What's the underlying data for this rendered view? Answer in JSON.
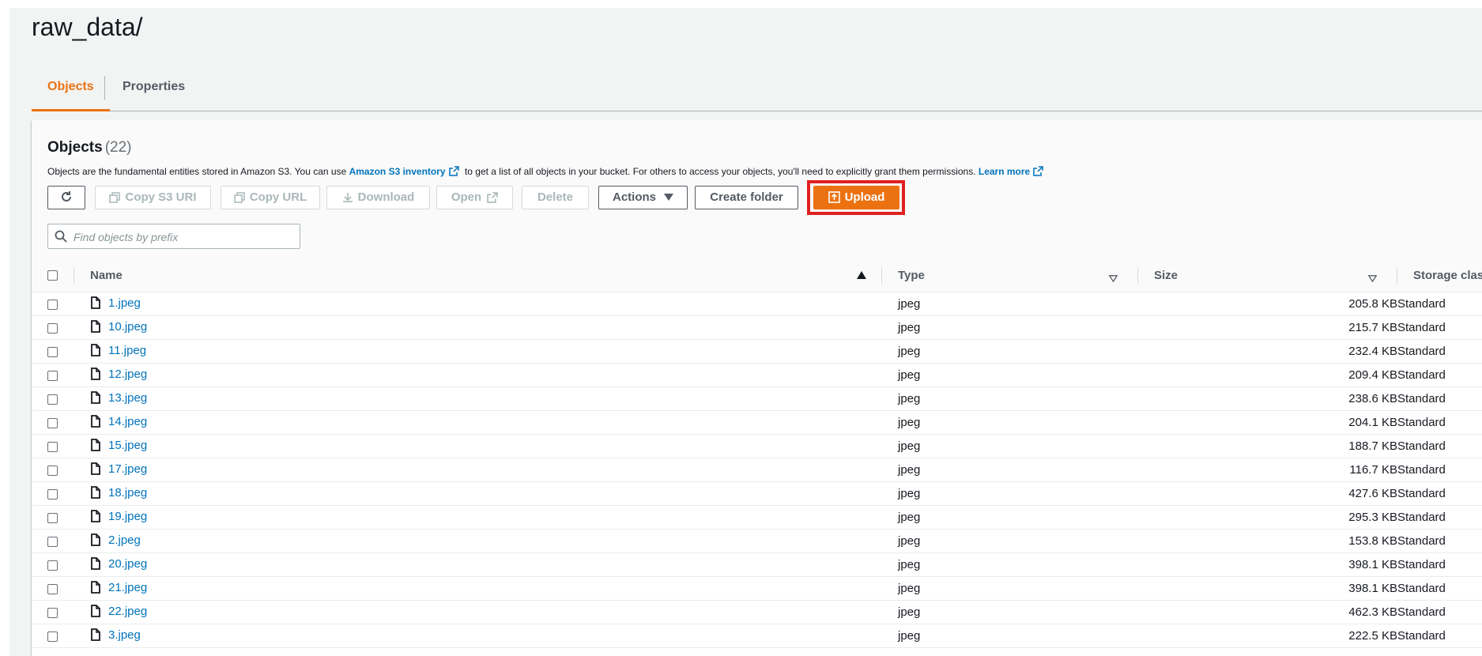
{
  "page": {
    "title": "raw_data/"
  },
  "tabs": [
    {
      "label": "Objects",
      "active": true
    },
    {
      "label": "Properties",
      "active": false
    }
  ],
  "objects_panel": {
    "heading": "Objects",
    "count": "(22)",
    "description": {
      "before": "Objects are the fundamental entities stored in Amazon S3. You can use ",
      "link1": "Amazon S3 inventory",
      "middle": " to get a list of all objects in your bucket. For others to access your objects, you'll need to explicitly grant them permissions. ",
      "link2": "Learn more"
    },
    "toolbar": {
      "refresh_icon": "refresh-icon",
      "copy_s3_uri": "Copy S3 URI",
      "copy_url": "Copy URL",
      "download": "Download",
      "open": "Open",
      "delete": "Delete",
      "actions": "Actions",
      "create_folder": "Create folder",
      "upload": "Upload"
    },
    "search": {
      "placeholder": "Find objects by prefix",
      "value": ""
    },
    "columns": [
      "Name",
      "Type",
      "Size",
      "Storage class"
    ],
    "rows": [
      {
        "name": "1.jpeg",
        "type": "jpeg",
        "size": "205.8 KB",
        "storage": "Standard"
      },
      {
        "name": "10.jpeg",
        "type": "jpeg",
        "size": "215.7 KB",
        "storage": "Standard"
      },
      {
        "name": "11.jpeg",
        "type": "jpeg",
        "size": "232.4 KB",
        "storage": "Standard"
      },
      {
        "name": "12.jpeg",
        "type": "jpeg",
        "size": "209.4 KB",
        "storage": "Standard"
      },
      {
        "name": "13.jpeg",
        "type": "jpeg",
        "size": "238.6 KB",
        "storage": "Standard"
      },
      {
        "name": "14.jpeg",
        "type": "jpeg",
        "size": "204.1 KB",
        "storage": "Standard"
      },
      {
        "name": "15.jpeg",
        "type": "jpeg",
        "size": "188.7 KB",
        "storage": "Standard"
      },
      {
        "name": "17.jpeg",
        "type": "jpeg",
        "size": "116.7 KB",
        "storage": "Standard"
      },
      {
        "name": "18.jpeg",
        "type": "jpeg",
        "size": "427.6 KB",
        "storage": "Standard"
      },
      {
        "name": "19.jpeg",
        "type": "jpeg",
        "size": "295.3 KB",
        "storage": "Standard"
      },
      {
        "name": "2.jpeg",
        "type": "jpeg",
        "size": "153.8 KB",
        "storage": "Standard"
      },
      {
        "name": "20.jpeg",
        "type": "jpeg",
        "size": "398.1 KB",
        "storage": "Standard"
      },
      {
        "name": "21.jpeg",
        "type": "jpeg",
        "size": "398.1 KB",
        "storage": "Standard"
      },
      {
        "name": "22.jpeg",
        "type": "jpeg",
        "size": "462.3 KB",
        "storage": "Standard"
      },
      {
        "name": "3.jpeg",
        "type": "jpeg",
        "size": "222.5 KB",
        "storage": "Standard"
      }
    ]
  },
  "colors": {
    "accent": "#ec7211",
    "link": "#0073bb",
    "highlight_box": "#e02020"
  }
}
